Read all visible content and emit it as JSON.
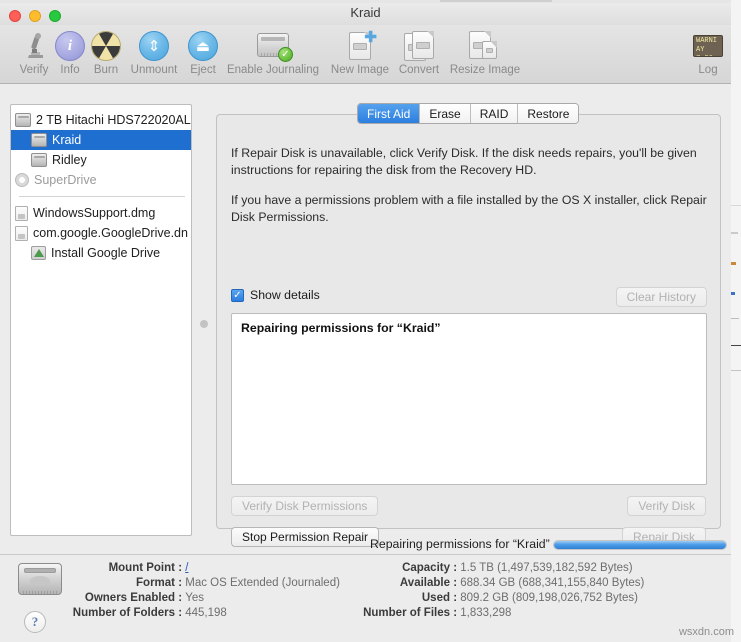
{
  "window": {
    "title": "Kraid"
  },
  "toolbar": {
    "items": [
      {
        "label": "Verify",
        "icon": "microscope-icon"
      },
      {
        "label": "Info",
        "icon": "info-icon"
      },
      {
        "label": "Burn",
        "icon": "burn-icon"
      },
      {
        "label": "Unmount",
        "icon": "unmount-icon"
      },
      {
        "label": "Eject",
        "icon": "eject-icon"
      },
      {
        "label": "Enable Journaling",
        "icon": "journaling-icon"
      },
      {
        "label": "New Image",
        "icon": "new-image-icon"
      },
      {
        "label": "Convert",
        "icon": "convert-icon"
      },
      {
        "label": "Resize Image",
        "icon": "resize-image-icon"
      },
      {
        "label": "Log",
        "icon": "log-icon"
      }
    ]
  },
  "sidebar": {
    "items": [
      {
        "label": "2 TB Hitachi HDS722020AL",
        "icon": "hard-disk-icon",
        "level": 0,
        "selected": false,
        "dim": false
      },
      {
        "label": "Kraid",
        "icon": "volume-icon",
        "level": 1,
        "selected": true,
        "dim": false
      },
      {
        "label": "Ridley",
        "icon": "volume-icon",
        "level": 1,
        "selected": false,
        "dim": false
      },
      {
        "label": "SuperDrive",
        "icon": "optical-drive-icon",
        "level": 0,
        "selected": false,
        "dim": true
      }
    ],
    "images": [
      {
        "label": "WindowsSupport.dmg",
        "icon": "disk-image-icon",
        "level": 0
      },
      {
        "label": "com.google.GoogleDrive.dn",
        "icon": "disk-image-icon",
        "level": 0
      },
      {
        "label": "Install Google Drive",
        "icon": "google-drive-icon",
        "level": 1
      }
    ]
  },
  "panel": {
    "tabs": [
      {
        "label": "First Aid",
        "active": true
      },
      {
        "label": "Erase",
        "active": false
      },
      {
        "label": "RAID",
        "active": false
      },
      {
        "label": "Restore",
        "active": false
      }
    ],
    "instructions": [
      "If Repair Disk is unavailable, click Verify Disk. If the disk needs repairs, you'll be given instructions for repairing the disk from the Recovery HD.",
      "If you have a permissions problem with a file installed by the OS X installer, click Repair Disk Permissions."
    ],
    "show_details_label": "Show details",
    "show_details_checked": true,
    "clear_history_label": "Clear History",
    "log_lines": [
      "Repairing permissions for “Kraid”"
    ],
    "buttons": {
      "verify_disk_permissions": "Verify Disk Permissions",
      "stop_permission_repair": "Stop Permission Repair",
      "verify_disk": "Verify Disk",
      "repair_disk": "Repair Disk"
    }
  },
  "progress": {
    "label": "Repairing permissions for “Kraid”",
    "percent": 100,
    "accent_color": "#2e7fd6"
  },
  "info": {
    "left": [
      {
        "key": "Mount Point",
        "value": "/",
        "is_link": true
      },
      {
        "key": "Format",
        "value": "Mac OS Extended (Journaled)",
        "is_link": false
      },
      {
        "key": "Owners Enabled",
        "value": "Yes",
        "is_link": false
      },
      {
        "key": "Number of Folders",
        "value": "445,198",
        "is_link": false
      }
    ],
    "right": [
      {
        "key": "Capacity",
        "value": "1.5 TB (1,497,539,182,592 Bytes)"
      },
      {
        "key": "Available",
        "value": "688.34 GB (688,341,155,840 Bytes)"
      },
      {
        "key": "Used",
        "value": "809.2 GB (809,198,026,752 Bytes)"
      },
      {
        "key": "Number of Files",
        "value": "1,833,298"
      }
    ],
    "help_label": "?"
  },
  "watermark": "wsxdn.com"
}
